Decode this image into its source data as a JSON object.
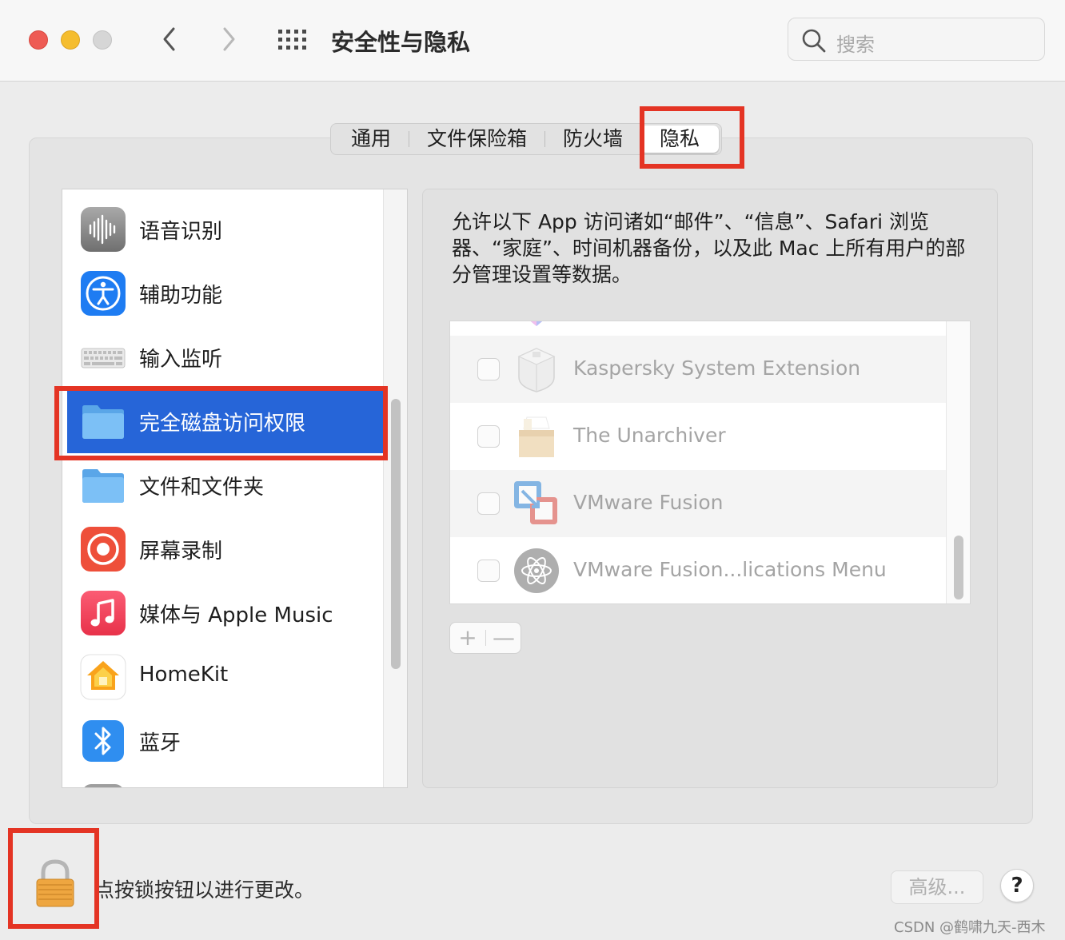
{
  "window": {
    "title": "安全性与隐私",
    "search_placeholder": "搜索"
  },
  "tabs": [
    {
      "label": "通用",
      "active": false
    },
    {
      "label": "文件保险箱",
      "active": false
    },
    {
      "label": "防火墙",
      "active": false
    },
    {
      "label": "隐私",
      "active": true
    }
  ],
  "sidebar": {
    "items": [
      {
        "label": "语音识别",
        "icon": "waveform-icon",
        "selected": false
      },
      {
        "label": "辅助功能",
        "icon": "accessibility-icon",
        "selected": false
      },
      {
        "label": "输入监听",
        "icon": "keyboard-icon",
        "selected": false
      },
      {
        "label": "完全磁盘访问权限",
        "icon": "folder-icon",
        "selected": true
      },
      {
        "label": "文件和文件夹",
        "icon": "folder-icon",
        "selected": false
      },
      {
        "label": "屏幕录制",
        "icon": "screen-record-icon",
        "selected": false
      },
      {
        "label": "媒体与 Apple Music",
        "icon": "music-icon",
        "selected": false
      },
      {
        "label": "HomeKit",
        "icon": "home-icon",
        "selected": false
      },
      {
        "label": "蓝牙",
        "icon": "bluetooth-icon",
        "selected": false
      }
    ]
  },
  "content": {
    "description": "允许以下 App 访问诸如“邮件”、“信息”、Safari 浏览器、“家庭”、时间机器备份，以及此 Mac 上所有用户的部分管理设置等数据。",
    "apps": [
      {
        "name": "Kaspersky System Extension",
        "checked": false,
        "icon": "kaspersky-icon"
      },
      {
        "name": "The Unarchiver",
        "checked": false,
        "icon": "unarchiver-icon"
      },
      {
        "name": "VMware Fusion",
        "checked": false,
        "icon": "vmware-icon"
      },
      {
        "name": "VMware Fusion...lications Menu",
        "checked": false,
        "icon": "vmware-menu-icon"
      }
    ],
    "add_label": "+",
    "remove_label": "—"
  },
  "footer": {
    "lock_text": "点按锁按钮以进行更改。",
    "advanced_label": "高级...",
    "help_label": "?"
  },
  "watermark": "CSDN @鹤啸九天-西木",
  "colors": {
    "selection": "#2665d8",
    "highlight_box": "#e43424"
  }
}
